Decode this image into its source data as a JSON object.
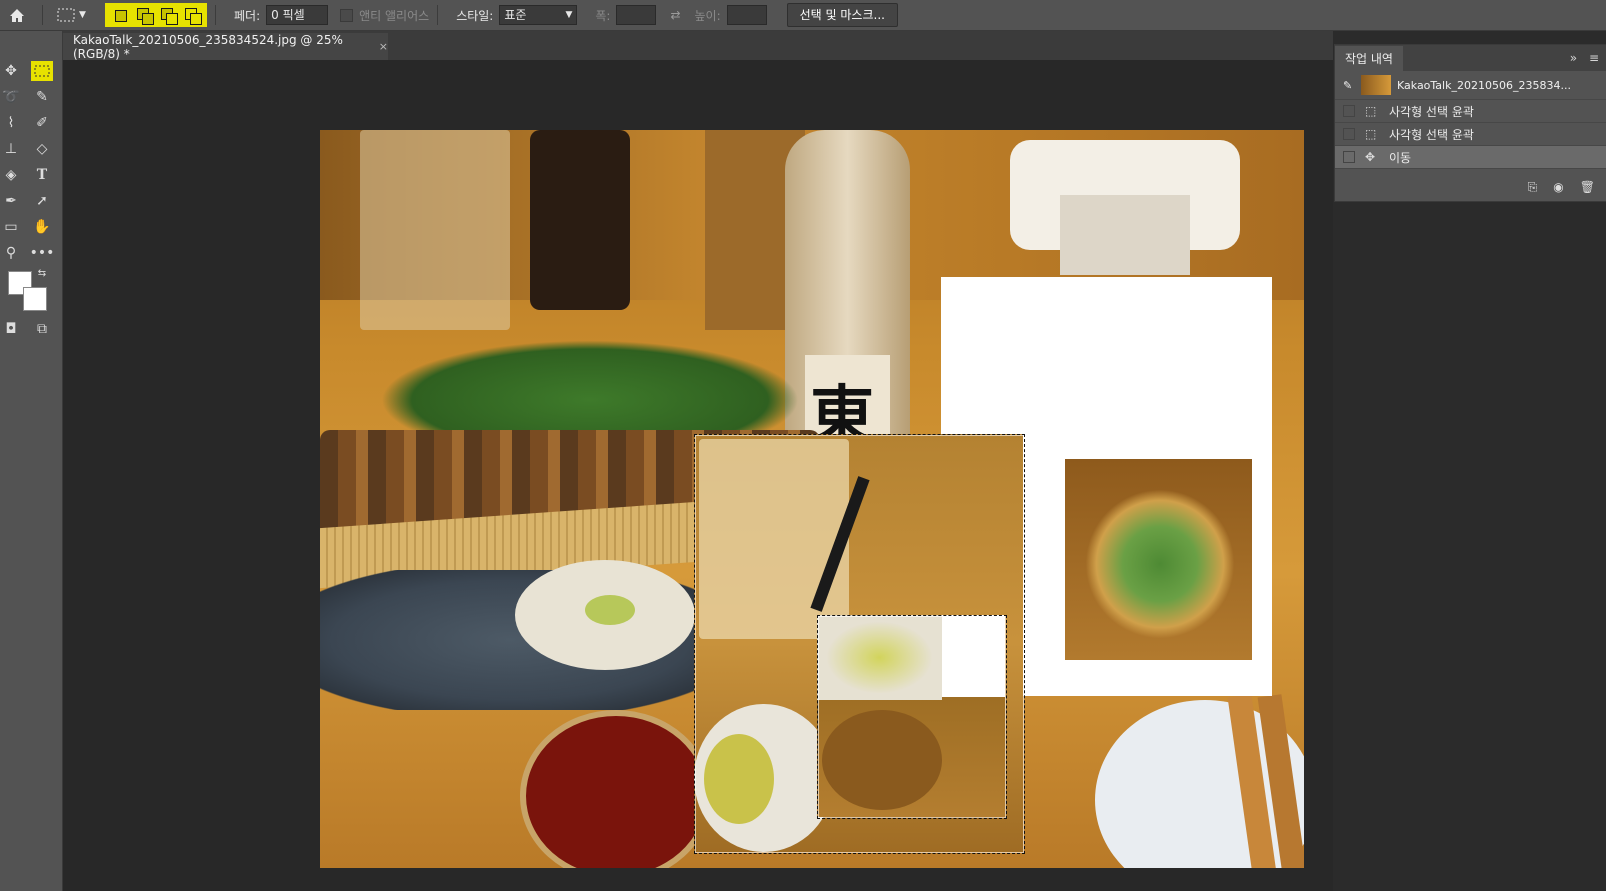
{
  "options_bar": {
    "feather_label": "페더:",
    "feather_value": "0 픽셀",
    "antialias_label": "앤티 앨리어스",
    "style_label": "스타일:",
    "style_value": "표준",
    "width_label": "폭:",
    "height_label": "높이:",
    "select_mask_label": "선택 및 마스크..."
  },
  "document_tab": {
    "title": "KakaoTalk_20210506_235834524.jpg @ 25% (RGB/8) *",
    "close": "×"
  },
  "history_panel": {
    "tab_label": "작업 내역",
    "collapse_glyph": "»",
    "menu_glyph": "≡",
    "snapshot_label": "KakaoTalk_20210506_235834...",
    "items": [
      {
        "label": "사각형 선택 윤곽",
        "icon": "rect-marquee-icon"
      },
      {
        "label": "사각형 선택 윤곽",
        "icon": "rect-marquee-icon"
      },
      {
        "label": "이동",
        "icon": "move-icon"
      }
    ]
  },
  "tools": [
    "move",
    "rect-marquee",
    "lasso",
    "quick-select",
    "eyedropper",
    "brush",
    "stamp",
    "eraser",
    "paint-bucket",
    "type",
    "pen",
    "path-select",
    "rectangle",
    "hand",
    "zoom",
    "more"
  ],
  "colors": {
    "highlight": "#e7e200",
    "panel_bg": "#535353",
    "canvas_bg": "#282828"
  }
}
